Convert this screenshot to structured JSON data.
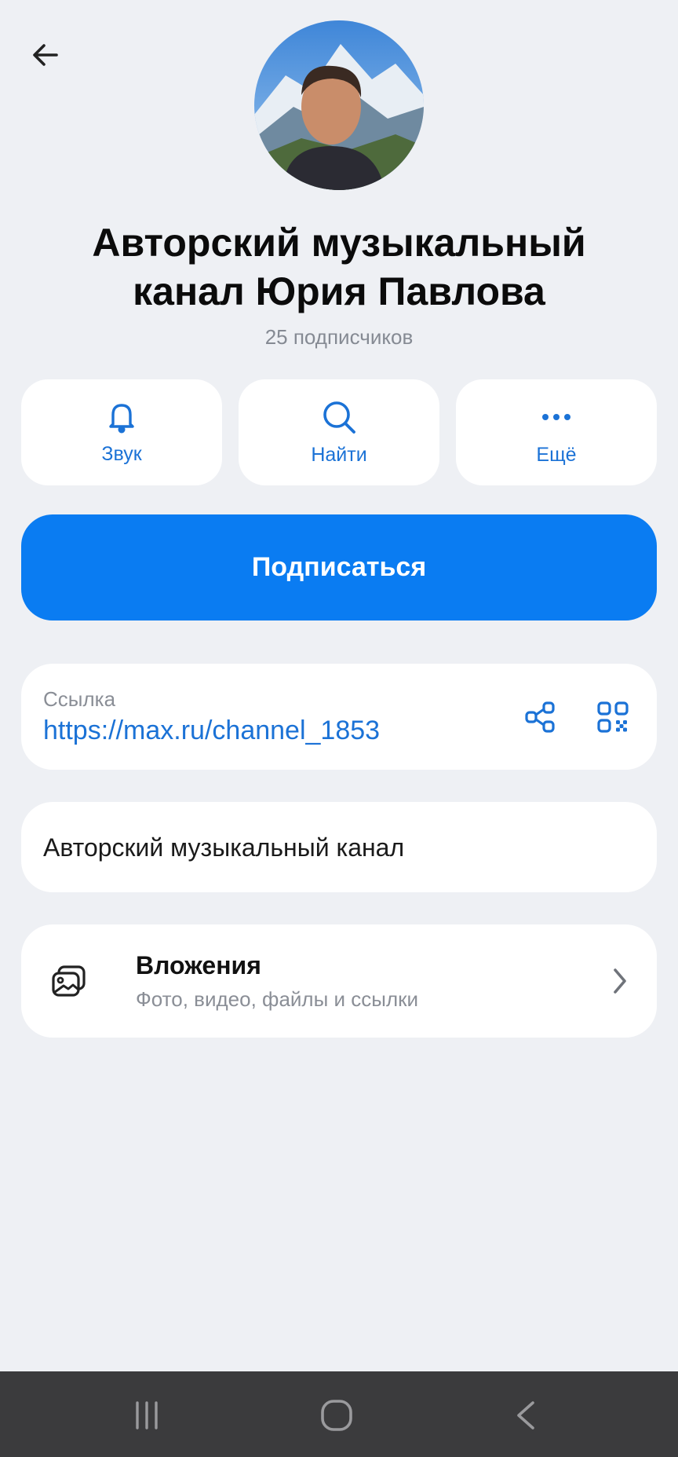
{
  "header": {
    "back_icon": "arrow-left-icon",
    "title_line1": "Авторский музыкальный",
    "title_line2": "канал Юрия Павлова",
    "subscribers": "25 подписчиков"
  },
  "actions": [
    {
      "label": "Звук",
      "icon": "bell-icon"
    },
    {
      "label": "Найти",
      "icon": "search-icon"
    },
    {
      "label": "Ещё",
      "icon": "more-dots-icon"
    }
  ],
  "subscribe_label": "Подписаться",
  "link": {
    "label": "Ссылка",
    "value": "https://max.ru/channel_1853",
    "share_icon": "share-icon",
    "qr_icon": "qr-code-icon"
  },
  "description": "Авторский музыкальный канал",
  "attachments": {
    "title": "Вложения",
    "subtitle": "Фото, видео, файлы и ссылки",
    "icon": "gallery-icon"
  },
  "system_nav": [
    "recent-apps-icon",
    "home-icon",
    "back-icon"
  ],
  "colors": {
    "accent": "#0a7cf2",
    "link": "#1b72d6",
    "background": "#eef0f4",
    "navbar": "#3b3b3d"
  }
}
